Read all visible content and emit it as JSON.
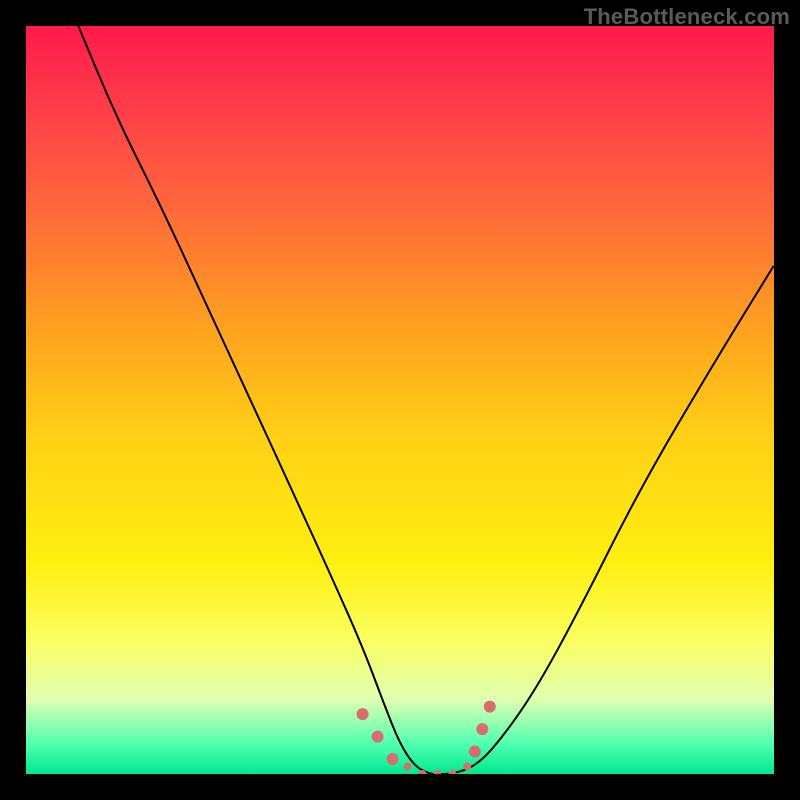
{
  "watermark": "TheBottleneck.com",
  "chart_data": {
    "type": "line",
    "title": "",
    "xlabel": "",
    "ylabel": "",
    "xlim": [
      0,
      100
    ],
    "ylim": [
      0,
      100
    ],
    "series": [
      {
        "name": "bottleneck-curve",
        "x": [
          7,
          12,
          18,
          24,
          30,
          36,
          41,
          45,
          48,
          50,
          52,
          54,
          55,
          57,
          60,
          63,
          68,
          74,
          82,
          92,
          100
        ],
        "y": [
          100,
          88,
          76,
          63,
          50,
          37,
          26,
          17,
          9,
          4,
          1,
          0,
          0,
          0,
          1,
          4,
          11,
          22,
          38,
          55,
          68
        ]
      }
    ],
    "markers": {
      "name": "highlight-points",
      "x": [
        45,
        47,
        49,
        51,
        53,
        55,
        57,
        59,
        60,
        61,
        62
      ],
      "y": [
        8,
        5,
        2,
        1,
        0,
        0,
        0,
        1,
        3,
        6,
        9
      ],
      "color": "#d66e6e",
      "size_small": 4,
      "size_large": 6
    },
    "gradient_stops": [
      {
        "pos": 0,
        "color": "#ff1a4a"
      },
      {
        "pos": 25,
        "color": "#ff6a3a"
      },
      {
        "pos": 55,
        "color": "#ffd015"
      },
      {
        "pos": 82,
        "color": "#fbff60"
      },
      {
        "pos": 100,
        "color": "#00e890"
      }
    ]
  }
}
